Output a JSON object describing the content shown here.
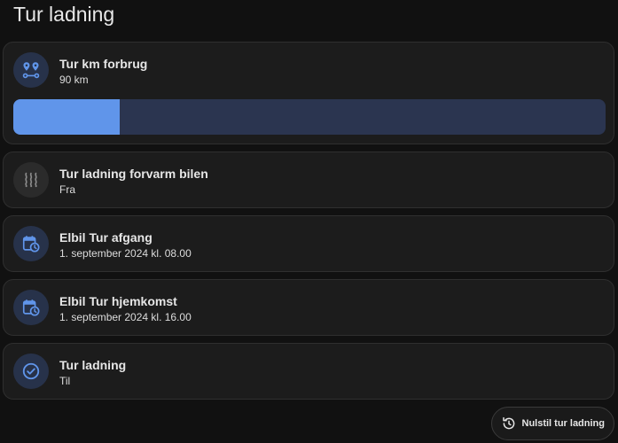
{
  "page": {
    "title": "Tur ladning"
  },
  "cards": [
    {
      "title": "Tur km forbrug",
      "value": "90 km",
      "icon": "map-marker-distance-icon",
      "progress_fraction": 0.18
    },
    {
      "title": "Tur ladning forvarm bilen",
      "value": "Fra",
      "icon": "heat-wave-icon"
    },
    {
      "title": "Elbil Tur afgang",
      "value": "1. september 2024 kl. 08.00",
      "icon": "calendar-clock-icon"
    },
    {
      "title": "Elbil Tur hjemkomst",
      "value": "1. september 2024 kl. 16.00",
      "icon": "calendar-clock-icon"
    },
    {
      "title": "Tur ladning",
      "value": "Til",
      "icon": "check-circle-icon"
    }
  ],
  "actions": {
    "reset_label": "Nulstil tur ladning",
    "reset_icon": "restore-icon"
  },
  "colors": {
    "accent": "#6095ea",
    "track": "#2b3550",
    "icon_active_bg": "#27324a",
    "icon_inactive": "#8a8a8a"
  }
}
